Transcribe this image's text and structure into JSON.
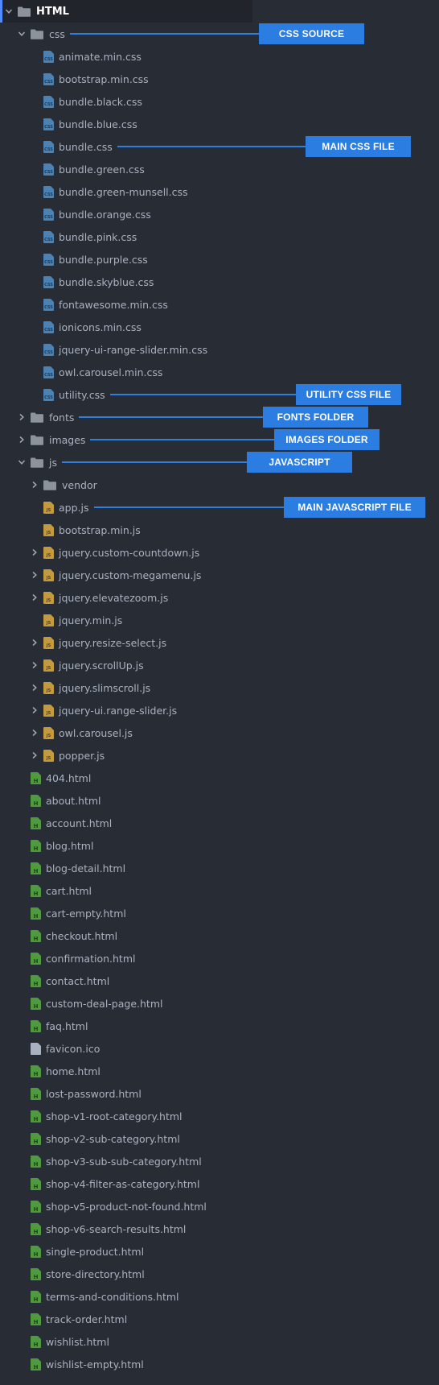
{
  "colors": {
    "background": "#282c34",
    "text": "#abb2bf",
    "annotation": "#2b7de2",
    "css_icon": "#4b82b3",
    "js_icon": "#c49a3e",
    "html_icon": "#4f9a3f"
  },
  "tree": [
    {
      "label": "HTML",
      "kind": "folder",
      "depth": 0,
      "expanded": true,
      "root": true
    },
    {
      "label": "css",
      "kind": "folder",
      "depth": 1,
      "expanded": true
    },
    {
      "label": "animate.min.css",
      "kind": "css",
      "depth": 2
    },
    {
      "label": "bootstrap.min.css",
      "kind": "css",
      "depth": 2
    },
    {
      "label": "bundle.black.css",
      "kind": "css",
      "depth": 2
    },
    {
      "label": "bundle.blue.css",
      "kind": "css",
      "depth": 2
    },
    {
      "label": "bundle.css",
      "kind": "css",
      "depth": 2
    },
    {
      "label": "bundle.green.css",
      "kind": "css",
      "depth": 2
    },
    {
      "label": "bundle.green-munsell.css",
      "kind": "css",
      "depth": 2
    },
    {
      "label": "bundle.orange.css",
      "kind": "css",
      "depth": 2
    },
    {
      "label": "bundle.pink.css",
      "kind": "css",
      "depth": 2
    },
    {
      "label": "bundle.purple.css",
      "kind": "css",
      "depth": 2
    },
    {
      "label": "bundle.skyblue.css",
      "kind": "css",
      "depth": 2
    },
    {
      "label": "fontawesome.min.css",
      "kind": "css",
      "depth": 2
    },
    {
      "label": "ionicons.min.css",
      "kind": "css",
      "depth": 2
    },
    {
      "label": "jquery-ui-range-slider.min.css",
      "kind": "css",
      "depth": 2
    },
    {
      "label": "owl.carousel.min.css",
      "kind": "css",
      "depth": 2
    },
    {
      "label": "utility.css",
      "kind": "css",
      "depth": 2
    },
    {
      "label": "fonts",
      "kind": "folder",
      "depth": 1,
      "expanded": false
    },
    {
      "label": "images",
      "kind": "folder",
      "depth": 1,
      "expanded": false
    },
    {
      "label": "js",
      "kind": "folder",
      "depth": 1,
      "expanded": true
    },
    {
      "label": "vendor",
      "kind": "folder",
      "depth": 2,
      "expanded": false
    },
    {
      "label": "app.js",
      "kind": "js",
      "depth": 2
    },
    {
      "label": "bootstrap.min.js",
      "kind": "js",
      "depth": 2
    },
    {
      "label": "jquery.custom-countdown.js",
      "kind": "js",
      "depth": 2,
      "collapsible": true
    },
    {
      "label": "jquery.custom-megamenu.js",
      "kind": "js",
      "depth": 2,
      "collapsible": true
    },
    {
      "label": "jquery.elevatezoom.js",
      "kind": "js",
      "depth": 2,
      "collapsible": true
    },
    {
      "label": "jquery.min.js",
      "kind": "js",
      "depth": 2
    },
    {
      "label": "jquery.resize-select.js",
      "kind": "js",
      "depth": 2,
      "collapsible": true
    },
    {
      "label": "jquery.scrollUp.js",
      "kind": "js",
      "depth": 2,
      "collapsible": true
    },
    {
      "label": "jquery.slimscroll.js",
      "kind": "js",
      "depth": 2,
      "collapsible": true
    },
    {
      "label": "jquery-ui.range-slider.js",
      "kind": "js",
      "depth": 2,
      "collapsible": true
    },
    {
      "label": "owl.carousel.js",
      "kind": "js",
      "depth": 2,
      "collapsible": true
    },
    {
      "label": "popper.js",
      "kind": "js",
      "depth": 2,
      "collapsible": true
    },
    {
      "label": "404.html",
      "kind": "html",
      "depth": 1
    },
    {
      "label": "about.html",
      "kind": "html",
      "depth": 1
    },
    {
      "label": "account.html",
      "kind": "html",
      "depth": 1
    },
    {
      "label": "blog.html",
      "kind": "html",
      "depth": 1
    },
    {
      "label": "blog-detail.html",
      "kind": "html",
      "depth": 1
    },
    {
      "label": "cart.html",
      "kind": "html",
      "depth": 1
    },
    {
      "label": "cart-empty.html",
      "kind": "html",
      "depth": 1
    },
    {
      "label": "checkout.html",
      "kind": "html",
      "depth": 1
    },
    {
      "label": "confirmation.html",
      "kind": "html",
      "depth": 1
    },
    {
      "label": "contact.html",
      "kind": "html",
      "depth": 1
    },
    {
      "label": "custom-deal-page.html",
      "kind": "html",
      "depth": 1
    },
    {
      "label": "faq.html",
      "kind": "html",
      "depth": 1
    },
    {
      "label": "favicon.ico",
      "kind": "ico",
      "depth": 1
    },
    {
      "label": "home.html",
      "kind": "html",
      "depth": 1
    },
    {
      "label": "lost-password.html",
      "kind": "html",
      "depth": 1
    },
    {
      "label": "shop-v1-root-category.html",
      "kind": "html",
      "depth": 1
    },
    {
      "label": "shop-v2-sub-category.html",
      "kind": "html",
      "depth": 1
    },
    {
      "label": "shop-v3-sub-sub-category.html",
      "kind": "html",
      "depth": 1
    },
    {
      "label": "shop-v4-filter-as-category.html",
      "kind": "html",
      "depth": 1
    },
    {
      "label": "shop-v5-product-not-found.html",
      "kind": "html",
      "depth": 1
    },
    {
      "label": "shop-v6-search-results.html",
      "kind": "html",
      "depth": 1
    },
    {
      "label": "single-product.html",
      "kind": "html",
      "depth": 1
    },
    {
      "label": "store-directory.html",
      "kind": "html",
      "depth": 1
    },
    {
      "label": "terms-and-conditions.html",
      "kind": "html",
      "depth": 1
    },
    {
      "label": "track-order.html",
      "kind": "html",
      "depth": 1
    },
    {
      "label": "wishlist.html",
      "kind": "html",
      "depth": 1
    },
    {
      "label": "wishlist-empty.html",
      "kind": "html",
      "depth": 1
    }
  ],
  "annotations": [
    {
      "text": "CSS SOURCE",
      "target": "css"
    },
    {
      "text": "MAIN CSS FILE",
      "target": "bundle.css"
    },
    {
      "text": "UTILITY CSS FILE",
      "target": "utility.css"
    },
    {
      "text": "FONTS FOLDER",
      "target": "fonts"
    },
    {
      "text": "IMAGES FOLDER",
      "target": "images"
    },
    {
      "text": "JAVASCRIPT",
      "target": "js"
    },
    {
      "text": "MAIN JAVASCRIPT FILE",
      "target": "app.js"
    }
  ],
  "icon_labels": {
    "css": "CSS",
    "js": "JS",
    "html": "H",
    "ico": ""
  }
}
